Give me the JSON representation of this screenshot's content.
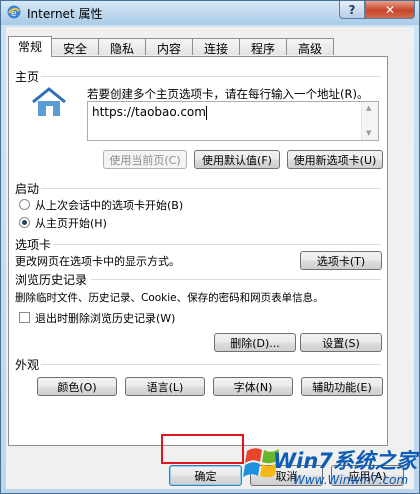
{
  "window": {
    "title": "Internet 属性",
    "help_label": "?",
    "close_label": "✕"
  },
  "tabs": [
    "常规",
    "安全",
    "隐私",
    "内容",
    "连接",
    "程序",
    "高级"
  ],
  "homepage": {
    "section": "主页",
    "hint": "若要创建多个主页选项卡，请在每行输入一个地址(R)。",
    "url": "https://taobao.com",
    "btn_current": "使用当前页(C)",
    "btn_default": "使用默认值(F)",
    "btn_new_tab": "使用新选项卡(U)"
  },
  "startup": {
    "section": "启动",
    "option_last": "从上次会话中的选项卡开始(B)",
    "option_home": "从主页开始(H)"
  },
  "tabs_section": {
    "section": "选项卡",
    "description": "更改网页在选项卡中的显示方式。",
    "btn_tabs": "选项卡(T)"
  },
  "history": {
    "section": "浏览历史记录",
    "description": "删除临时文件、历史记录、Cookie、保存的密码和网页表单信息。",
    "checkbox_label": "退出时删除浏览历史记录(W)",
    "btn_delete": "删除(D)...",
    "btn_settings": "设置(S)"
  },
  "appearance": {
    "section": "外观",
    "btn_colors": "颜色(O)",
    "btn_languages": "语言(L)",
    "btn_fonts": "字体(N)",
    "btn_accessibility": "辅助功能(E)"
  },
  "footer": {
    "ok": "确定",
    "cancel": "取消",
    "apply": "应用(A)"
  },
  "watermark": {
    "line1": "Win7系统之家",
    "line2": "Www.Winwin7.com"
  }
}
